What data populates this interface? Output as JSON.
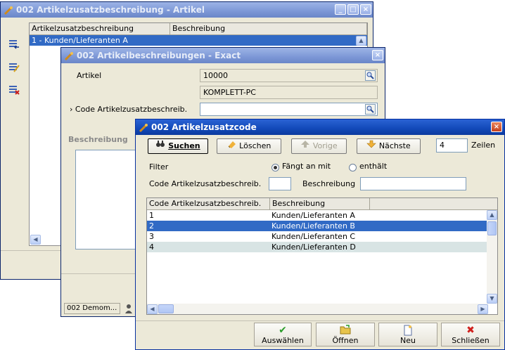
{
  "win1": {
    "title": "002 Artikelzusatzbeschreibung - Artikel",
    "columns": [
      "Artikelzusatzbeschreibung",
      "Beschreibung"
    ],
    "rows": [
      [
        "1  - Kunden/Lieferanten A",
        ""
      ]
    ]
  },
  "win2": {
    "title": "002 Artikelbeschreibungen - Exact",
    "artikel_label": "Artikel",
    "artikel_value": "10000",
    "artikel_desc": "KOMPLETT-PC",
    "code_label": "› Code Artikelzusatzbeschreib.",
    "code_value": "",
    "beschreibung_label": "Beschreibung",
    "status_text": "002 Demom..."
  },
  "dialog": {
    "title": "002 Artikelzusatzcode",
    "toolbar": {
      "suchen": "Suchen",
      "loeschen": "Löschen",
      "vorige": "Vorige",
      "naechste": "Nächste",
      "count": "4",
      "zeilen": "Zeilen"
    },
    "filter": {
      "label": "Filter",
      "option_starts": "Fängt an mit",
      "option_contains": "enthält",
      "selected": "Fängt an mit",
      "code_label": "Code Artikelzusatzbeschreib.",
      "code_value": "",
      "desc_label": "Beschreibung",
      "desc_value": ""
    },
    "grid": {
      "columns": [
        "Code Artikelzusatzbeschreib.",
        "Beschreibung"
      ],
      "rows": [
        {
          "code": "1",
          "desc": "Kunden/Lieferanten A"
        },
        {
          "code": "2",
          "desc": "Kunden/Lieferanten B"
        },
        {
          "code": "3",
          "desc": "Kunden/Lieferanten C"
        },
        {
          "code": "4",
          "desc": "Kunden/Lieferanten D"
        }
      ],
      "selected_row": 2
    },
    "buttons": {
      "auswaehlen": "Auswählen",
      "oeffnen": "Öffnen",
      "neu": "Neu",
      "schliessen": "Schließen"
    }
  },
  "colors": {
    "title_active": "#1249b8",
    "title_inactive": "#7c97d6",
    "selection": "#316ac5",
    "face": "#ece9d8"
  },
  "icons": [
    "app-icon",
    "binoculars-icon",
    "eraser-icon",
    "arrow-up-icon",
    "arrow-down-icon",
    "checkmark-icon",
    "folder-icon",
    "new-document-icon",
    "delete-x-icon"
  ]
}
